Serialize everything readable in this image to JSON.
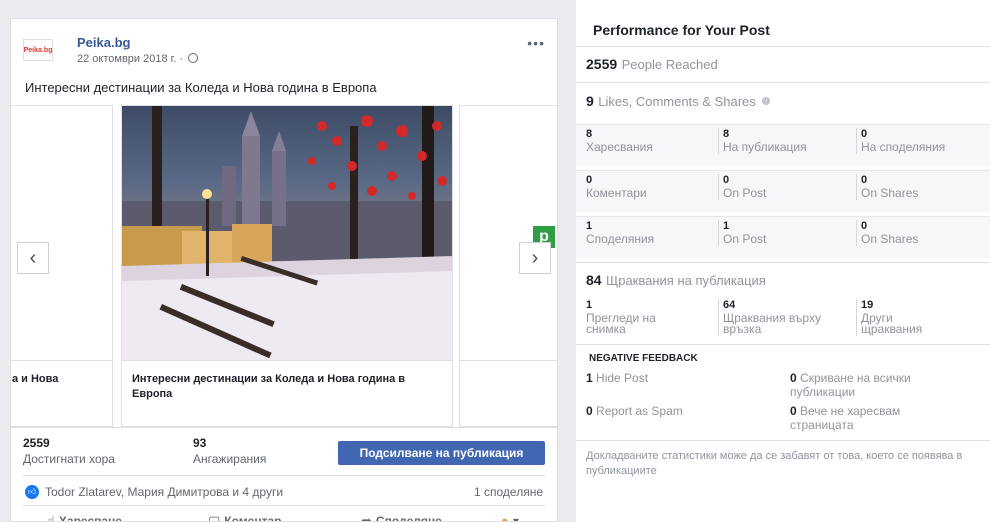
{
  "post": {
    "page_name": "Peika.bg",
    "logo_text": "Peika.bg",
    "date": "22 октомври 2018 г. ·",
    "text": "Интересни дестинации за Коледа и Нова година в Европа",
    "carousel": {
      "left_card_title": "а и Нова",
      "main_card_title": "Интересни дестинации за Коледа и Нова година в Европа",
      "green_tag": "p"
    },
    "stats": {
      "reached_num": "2559",
      "reached_label": "Достигнати хора",
      "engagements_num": "93",
      "engagements_label": "Ангажирания",
      "boost_label": "Подсилване на публикация"
    },
    "reactions": {
      "names": "Todor Zlatarev, Мария Димитрова и 4 други",
      "shares": "1 споделяне"
    },
    "actions": {
      "like": "Харесване",
      "comment": "Коментар",
      "share": "Споделяне"
    }
  },
  "panel": {
    "title": "Performance for Your Post",
    "reached": {
      "num": "2559",
      "label": "People Reached"
    },
    "engagement": {
      "num": "9",
      "label": "Likes, Comments & Shares"
    },
    "rows": [
      [
        {
          "num": "8",
          "label": "Харесвания"
        },
        {
          "num": "8",
          "label": "На публикация"
        },
        {
          "num": "0",
          "label": "На споделяния"
        }
      ],
      [
        {
          "num": "0",
          "label": "Коментари"
        },
        {
          "num": "0",
          "label": "On Post"
        },
        {
          "num": "0",
          "label": "On Shares"
        }
      ],
      [
        {
          "num": "1",
          "label": "Споделяния"
        },
        {
          "num": "1",
          "label": "On Post"
        },
        {
          "num": "0",
          "label": "On Shares"
        }
      ]
    ],
    "clicks": {
      "num": "84",
      "label": "Щраквания на публикация"
    },
    "click_row": [
      {
        "num": "1",
        "label1": "Прегледи на",
        "label2": "снимка"
      },
      {
        "num": "64",
        "label1": "Щраквания върху",
        "label2": "връзка"
      },
      {
        "num": "19",
        "label1": "Други",
        "label2": "щраквания"
      }
    ],
    "negative": {
      "heading": "NEGATIVE FEEDBACK",
      "hide_post_num": "1",
      "hide_post": "Hide Post",
      "hide_all_num": "0",
      "hide_all_1": "Скриване на всички",
      "hide_all_2": "публикации",
      "spam_num": "0",
      "spam": "Report as Spam",
      "unlike_num": "0",
      "unlike_1": "Вече не харесвам",
      "unlike_2": "страницата"
    },
    "footnote": "Докладваните статистики може да се забавят от това, което се появява в публикациите"
  }
}
